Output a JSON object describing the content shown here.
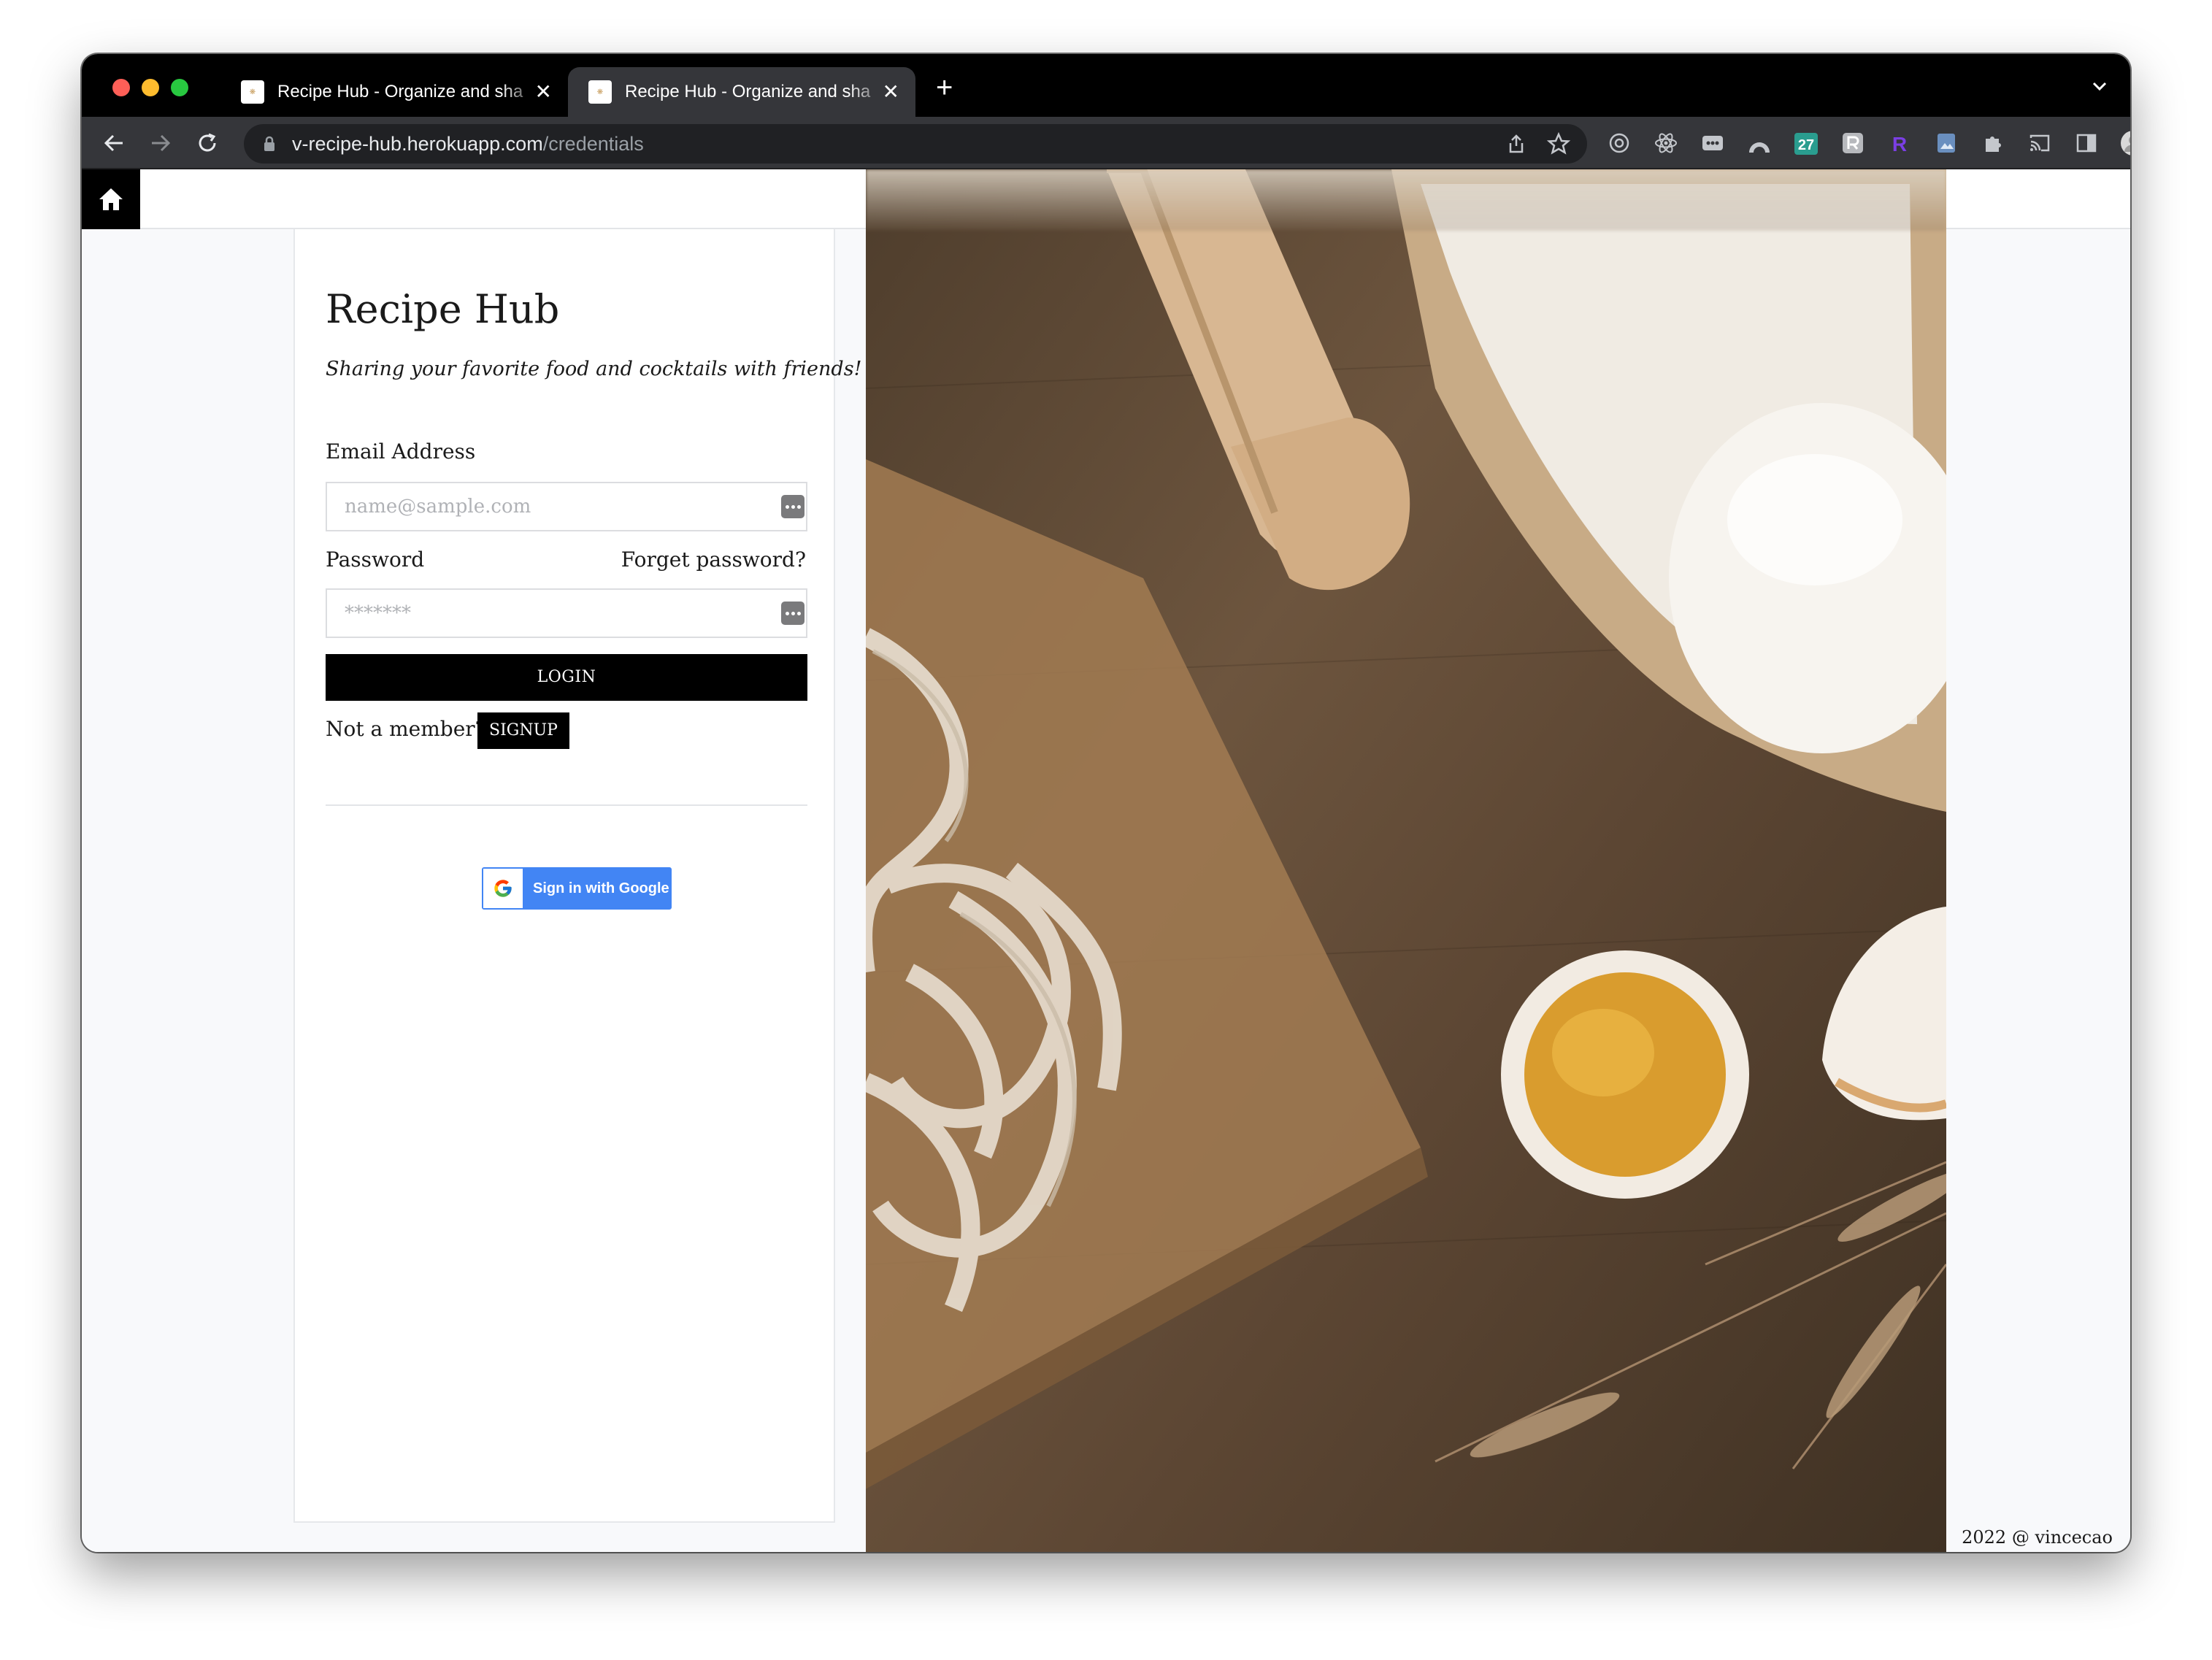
{
  "browser": {
    "tabs": [
      {
        "title": "Recipe Hub - Organize and sha",
        "active": false
      },
      {
        "title": "Recipe Hub - Organize and sha",
        "active": true
      }
    ],
    "url_host": "v-recipe-hub.herokuapp.com",
    "url_path": "/credentials",
    "extensions": [
      "chatgpt-icon",
      "react-devtools-icon",
      "password-manager-icon",
      "arc-icon",
      "calendar-27-icon",
      "grammar-icon",
      "r-extension-icon",
      "screenshot-icon",
      "puzzle-icon",
      "cast-icon",
      "sidepanel-icon",
      "profile-avatar-icon",
      "more-icon"
    ],
    "calendar_ext_label": "27",
    "r_ext_label": "R"
  },
  "login": {
    "brand": "Recipe Hub",
    "tagline": "Sharing your favorite food and cocktails with friends!",
    "email_label": "Email Address",
    "email_placeholder": "name@sample.com",
    "password_label": "Password",
    "forgot_password": "Forget password?",
    "password_placeholder": "*******",
    "login_button": "LOGIN",
    "not_member": "Not a member?",
    "signup_button": "SIGNUP",
    "google_button": "Sign in with Google"
  },
  "footer": {
    "text": "2022 @ vincecao"
  },
  "colors": {
    "accent": "#000000",
    "google_blue": "#4285f4",
    "page_bg": "#f8f9fb"
  }
}
